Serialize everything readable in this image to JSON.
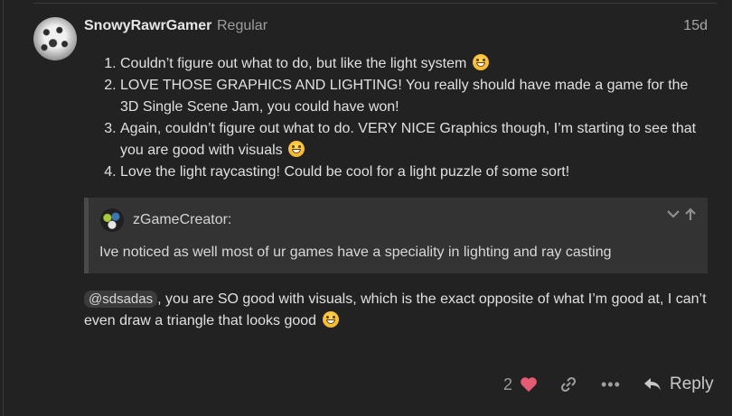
{
  "post": {
    "username": "SnowyRawrGamer",
    "user_title": "Regular",
    "date": "15d",
    "list_items": [
      "Couldn’t figure out what to do, but like the light system",
      "LOVE THOSE GRAPHICS AND LIGHTING! You really should have made a game for the 3D Single Scene Jam, you could have won!",
      "Again, couldn’t figure out what to do. VERY NICE Graphics though, I’m starting to see that you are good with visuals",
      "Love the light raycasting! Could be cool for a light puzzle of some sort!"
    ],
    "quote": {
      "author": "zGameCreator:",
      "text": "Ive noticed as well most of ur games have a speciality in lighting and ray casting"
    },
    "reply": {
      "mention": "@sdsadas",
      "text": ", you are SO good with visuals, which is the exact opposite of what I’m good at, I can’t even draw a triangle that looks good"
    },
    "actions": {
      "like_count": "2",
      "reply_label": "Reply",
      "more_label": "•••"
    },
    "icons": {
      "heart": "heart-icon",
      "link": "link-icon",
      "more": "more-icon",
      "reply": "reply-icon",
      "expand": "chevron-down-icon",
      "jump": "arrow-up-icon",
      "emoji": "grinning-emoji-icon"
    },
    "colors": {
      "background": "#222222",
      "heart": "#e45b74",
      "text": "#dddddd"
    }
  }
}
